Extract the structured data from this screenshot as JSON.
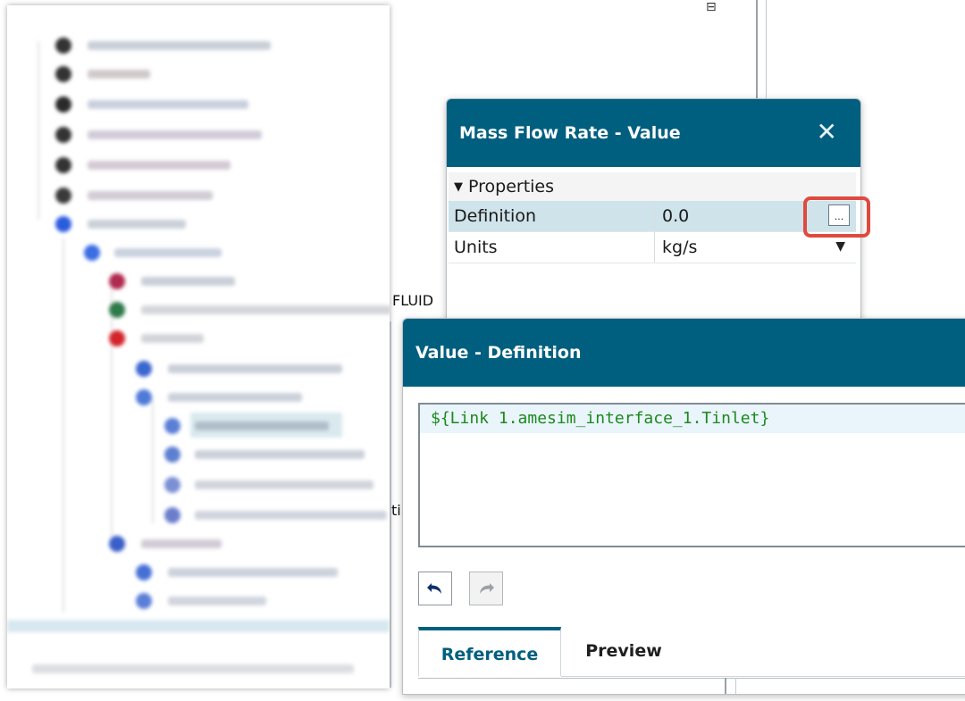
{
  "background": {
    "fluid_fragment": "FLUID",
    "ti_fragment": "ti"
  },
  "dialog_mass_flow": {
    "title": "Mass Flow Rate - Value",
    "close_label": "✕",
    "group_label": "Properties",
    "rows": [
      {
        "name": "Definition",
        "value": "0.0"
      },
      {
        "name": "Units",
        "value": "kg/s"
      }
    ],
    "ellipsis_label": "...",
    "highlight_color": "#e0493f"
  },
  "dialog_value_definition": {
    "title": "Value - Definition",
    "expression": "${Link 1.amesim_interface_1.Tinlet}",
    "tabs": [
      {
        "label": "Reference"
      },
      {
        "label": "Preview"
      }
    ]
  },
  "colors": {
    "title_bar": "#005f7f",
    "selected_row": "#cfe3ea",
    "expression_text": "#1c8a1c"
  }
}
